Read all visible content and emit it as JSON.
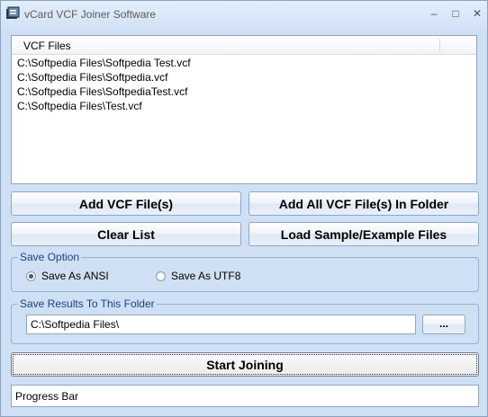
{
  "window": {
    "title": "vCard VCF Joiner Software",
    "controls": {
      "minimize": "–",
      "maximize": "□",
      "close": "✕"
    }
  },
  "file_list": {
    "header": "VCF Files",
    "items": [
      "C:\\Softpedia Files\\Softpedia Test.vcf",
      "C:\\Softpedia Files\\Softpedia.vcf",
      "C:\\Softpedia Files\\SoftpediaTest.vcf",
      "C:\\Softpedia Files\\Test.vcf"
    ]
  },
  "buttons": {
    "add_files": "Add VCF File(s)",
    "add_folder": "Add All VCF File(s) In Folder",
    "clear_list": "Clear List",
    "load_sample": "Load Sample/Example Files",
    "start": "Start Joining",
    "browse": "..."
  },
  "save_option": {
    "legend": "Save Option",
    "options": [
      {
        "label": "Save As ANSI",
        "checked": true
      },
      {
        "label": "Save As UTF8",
        "checked": false
      }
    ]
  },
  "save_folder": {
    "legend": "Save Results To This Folder",
    "value": "C:\\Softpedia Files\\"
  },
  "progress": {
    "label": "Progress Bar",
    "value": 0
  },
  "colors": {
    "window_bg": "#cfe0f4",
    "legend_text": "#1d3e85"
  }
}
